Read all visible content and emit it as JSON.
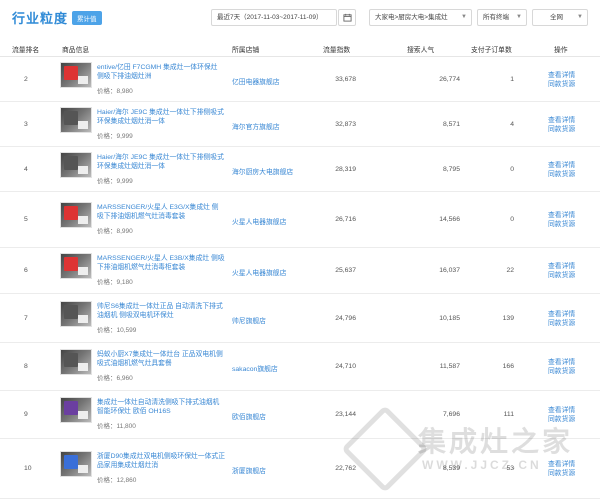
{
  "header": {
    "title": "行业粒度",
    "badge": "累计值",
    "date_range": "最近7天（2017-11-03~2017-11-09）",
    "category": "大家电>厨房大电>集成灶",
    "terminal": "所有终端",
    "network": "全网",
    "icons": {
      "calendar": "calendar-icon",
      "dropdown": "chevron-down-icon"
    }
  },
  "columns": [
    "流量排名",
    "商品信息",
    "所属店铺",
    "流量指数",
    "搜索人气",
    "支付子订单数",
    "操作"
  ],
  "rows": [
    {
      "rank": "2",
      "name": "entive/亿田 F7CGMH 集成灶一体环保灶 侧吸下排油烟灶洲",
      "price": "价格：8,980",
      "shop": "亿田电器旗舰店",
      "flow": "33,678",
      "search": "26,774",
      "orders": "1",
      "op1": "查看详情",
      "op2": "同款货源"
    },
    {
      "rank": "3",
      "name": "Haier/海尔 JE9C 集成灶一体灶下排侧吸式环保集成灶烟灶消一体",
      "price": "价格：9,999",
      "shop": "海尔官方旗舰店",
      "flow": "32,873",
      "search": "8,571",
      "orders": "4",
      "op1": "查看详情",
      "op2": "同款货源"
    },
    {
      "rank": "4",
      "name": "Haier/海尔 JE9C 集成灶一体灶下排侧吸式环保集成灶烟灶消一体",
      "price": "价格：9,999",
      "shop": "海尔厨房大电旗舰店",
      "flow": "28,319",
      "search": "8,795",
      "orders": "0",
      "op1": "查看详情",
      "op2": "同款货源"
    },
    {
      "rank": "5",
      "name": "MARSSENGER/火星人 E3G/X集成灶 侧吸下排油烟机燃气灶消毒套装",
      "price": "价格：8,990",
      "shop": "火星人电器旗舰店",
      "flow": "26,716",
      "search": "14,566",
      "orders": "0",
      "op1": "查看详情",
      "op2": "同款货源"
    },
    {
      "rank": "6",
      "name": "MARSSENGER/火星人 E3B/X集成灶 侧吸下排油烟机燃气灶消毒柜套装",
      "price": "价格：9,180",
      "shop": "火星人电器旗舰店",
      "flow": "25,637",
      "search": "16,037",
      "orders": "22",
      "op1": "查看详情",
      "op2": "同款货源"
    },
    {
      "rank": "7",
      "name": "帅尼S6集成灶一体灶正品 自动清洗下排式油烟机 侧吸双电机环保灶",
      "price": "价格：10,599",
      "shop": "帅尼旗舰店",
      "flow": "24,796",
      "search": "10,185",
      "orders": "139",
      "op1": "查看详情",
      "op2": "同款货源"
    },
    {
      "rank": "8",
      "name": "蚂蚁小厨X7集成灶一体灶台 正品双电机侧吸式油烟机燃气灶具套餐",
      "price": "价格：6,960",
      "shop": "sakacon旗舰店",
      "flow": "24,710",
      "search": "11,587",
      "orders": "166",
      "op1": "查看详情",
      "op2": "同款货源"
    },
    {
      "rank": "9",
      "name": "集成灶一体灶自动清洗侧吸下排式油烟机 智能环保灶 欧佰 OH16S",
      "price": "价格：11,800",
      "shop": "欧佰旗舰店",
      "flow": "23,144",
      "search": "7,696",
      "orders": "111",
      "op1": "查看详情",
      "op2": "同款货源"
    },
    {
      "rank": "10",
      "name": "浙厦D90集成灶双电机侧吸环保灶一体式正品家用集成灶烟灶消",
      "price": "价格：12,860",
      "shop": "浙厦旗舰店",
      "flow": "22,762",
      "search": "8,539",
      "orders": "53",
      "op1": "查看详情",
      "op2": "同款货源"
    }
  ],
  "watermark": {
    "text": "集成灶之家",
    "url": "WWW.JJCZ.CN"
  }
}
